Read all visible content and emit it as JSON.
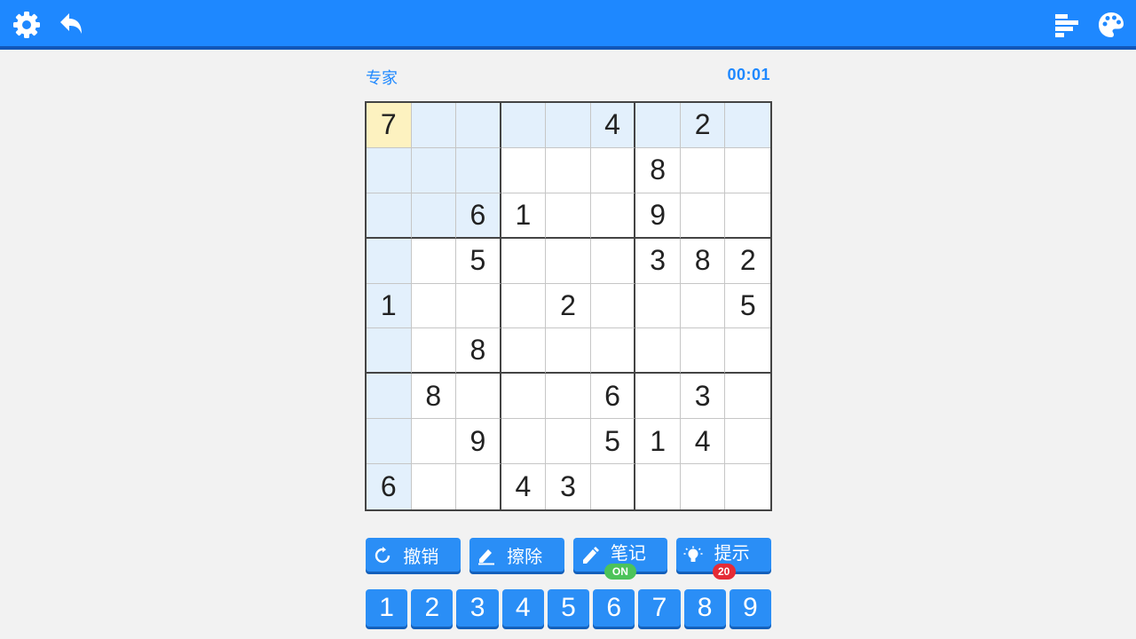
{
  "toolbar": {
    "left_icons": [
      "gear-icon",
      "undo-arrow-icon"
    ],
    "right_icons": [
      "leaderboard-icon",
      "palette-icon"
    ],
    "bar_color": "#1e88ff"
  },
  "game": {
    "level": "专家",
    "timer": "00:01",
    "selected_cell": [
      0,
      0
    ],
    "grid": [
      [
        "7",
        "",
        "",
        "",
        "",
        "4",
        "",
        "2",
        ""
      ],
      [
        "",
        "",
        "",
        "",
        "",
        "",
        "8",
        "",
        ""
      ],
      [
        "",
        "",
        "6",
        "1",
        "",
        "",
        "9",
        "",
        ""
      ],
      [
        "",
        "",
        "5",
        "",
        "",
        "",
        "3",
        "8",
        "2"
      ],
      [
        "1",
        "",
        "",
        "",
        "2",
        "",
        "",
        "",
        "5"
      ],
      [
        "",
        "",
        "8",
        "",
        "",
        "",
        "",
        "",
        ""
      ],
      [
        "",
        "8",
        "",
        "",
        "",
        "6",
        "",
        "3",
        ""
      ],
      [
        "",
        "",
        "9",
        "",
        "",
        "5",
        "1",
        "4",
        ""
      ],
      [
        "6",
        "",
        "",
        "4",
        "3",
        "",
        "",
        "",
        ""
      ]
    ]
  },
  "actions": {
    "undo": {
      "label": "撤销",
      "icon": "refresh-icon"
    },
    "erase": {
      "label": "擦除",
      "icon": "eraser-icon"
    },
    "notes": {
      "label": "笔记",
      "icon": "pencil-icon",
      "state": "ON"
    },
    "hint": {
      "label": "提示",
      "icon": "lightbulb-icon",
      "count": "20"
    }
  },
  "numpad": [
    "1",
    "2",
    "3",
    "4",
    "5",
    "6",
    "7",
    "8",
    "9"
  ],
  "colors": {
    "accent": "#2a8ef6",
    "highlight": "#e3f0fc",
    "selected": "#fdf2c0",
    "on_badge": "#4cc35a",
    "hint_badge": "#e52b36"
  }
}
